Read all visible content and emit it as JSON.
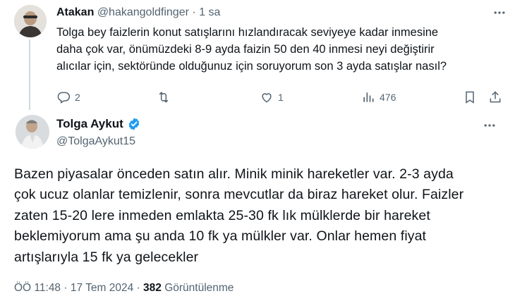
{
  "reply": {
    "author_name": "Atakan",
    "handle": "@hakangoldfinger",
    "separator": "·",
    "time": "1 sa",
    "text_lines": [
      "Tolga bey faizlerin konut satışlarını hızlandıracak seviyeye kadar inmesine",
      "daha çok var, önümüzdeki 8-9 ayda faizin 50 den 40 inmesi neyi değiştirir",
      "alıcılar için, sektöründe olduğunuz için soruyorum son 3 ayda satışlar nasıl?"
    ],
    "actions": {
      "replies": "2",
      "retweets": "",
      "likes": "1",
      "views": "476"
    },
    "icons": [
      "more-icon",
      "reply-icon",
      "retweet-icon",
      "like-icon",
      "views-icon",
      "bookmark-icon",
      "share-icon"
    ]
  },
  "main": {
    "author_name": "Tolga Aykut",
    "handle": "@TolgaAykut15",
    "verified": true,
    "verified_color": "#1d9bf0",
    "text_lines": [
      "Bazen piyasalar önceden satın alır. Minik minik hareketler var. 2-3 ayda",
      "çok ucuz olanlar temizlenir, sonra mevcutlar da biraz hareket olur. Faizler",
      "zaten 15-20 lere inmeden emlakta 25-30 fk lık mülklerde bir hareket",
      "beklemiyorum ama şu anda 10 fk ya mülkler var. Onlar hemen fiyat",
      "artışlarıyla 15 fk ya gelecekler"
    ],
    "footer": {
      "time": "ÖÖ 11:48",
      "separator": "·",
      "date": "17 Tem 2024",
      "separator2": "·",
      "views_count": "382",
      "views_label": "Görüntülenme"
    }
  },
  "colors": {
    "text": "#0f1419",
    "muted": "#536471",
    "thread_line": "#cfd9de"
  }
}
